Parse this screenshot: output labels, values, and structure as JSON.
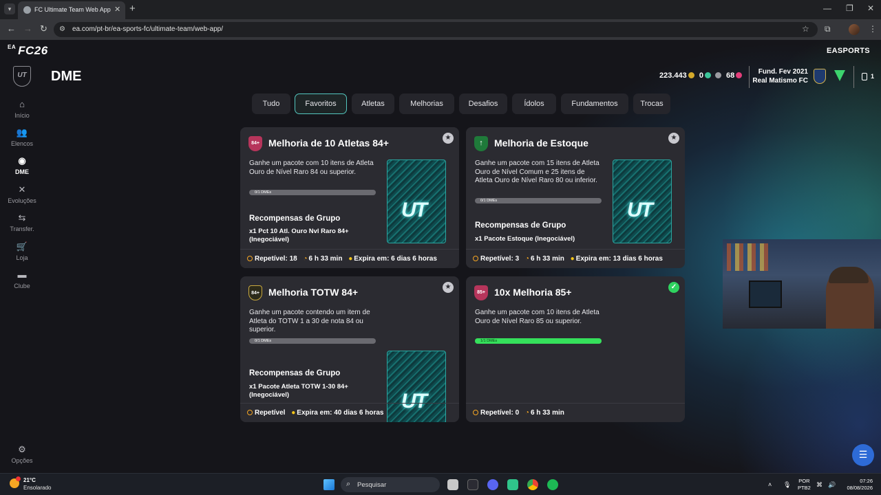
{
  "browser": {
    "tab_title": "FC Ultimate Team Web App - E",
    "url": "ea.com/pt-br/ea-sports-fc/ultimate-team/web-app/"
  },
  "app": {
    "brand": "FC26",
    "brand_prefix": "EA",
    "publisher": "EASPORTS",
    "page_title": "DME",
    "badge_text": "UT"
  },
  "sidebar": {
    "items": [
      {
        "label": "Início",
        "icon": "home-icon"
      },
      {
        "label": "Elencos",
        "icon": "squad-icon"
      },
      {
        "label": "DME",
        "icon": "sbc-icon"
      },
      {
        "label": "Evoluções",
        "icon": "evolutions-icon"
      },
      {
        "label": "Transfer.",
        "icon": "transfer-icon"
      },
      {
        "label": "Loja",
        "icon": "store-icon"
      },
      {
        "label": "Clube",
        "icon": "club-icon"
      }
    ],
    "options_label": "Opções"
  },
  "header": {
    "coins": "223.443",
    "points": "0",
    "fc_points": "68",
    "club_founded": "Fund. Fev 2021",
    "club_name": "Real Matismo FC",
    "inbox_count": "1"
  },
  "filter_tabs": [
    "Tudo",
    "Favoritos",
    "Atletas",
    "Melhorias",
    "Desafios",
    "Ídolos",
    "Fundamentos",
    "Trocas"
  ],
  "selected_tab": "Favoritos",
  "cards": [
    {
      "title": "Melhoria de 10 Atletas 84+",
      "badge": "84+",
      "description": "Ganhe um pacote com 10 itens de Atleta Ouro de Nível Raro 84 ou superior.",
      "progress_label": "0/1 DMEs",
      "progress": 0,
      "group_title": "Recompensas de Grupo",
      "group_reward": "x1 Pct 10 Atl. Ouro Nvl Raro 84+ (Inegociável)",
      "repeatable": "Repetível: 18",
      "timer": "6 h 33 min",
      "expires": "Expira em: 6 dias 6 horas",
      "favorite": true
    },
    {
      "title": "Melhoria de Estoque",
      "badge": "↑",
      "description": "Ganhe um pacote com 15 itens de Atleta Ouro de Nível Comum e 25 itens de Atleta Ouro de Nível Raro 80 ou inferior.",
      "progress_label": "0/1 DMEs",
      "progress": 0,
      "group_title": "Recompensas de Grupo",
      "group_reward": "x1 Pacote Estoque (Inegociável)",
      "repeatable": "Repetível: 3",
      "timer": "6 h 33 min",
      "expires": "Expira em: 13 dias 6 horas",
      "favorite": true
    },
    {
      "title": "Melhoria TOTW 84+",
      "badge": "84+",
      "description": "Ganhe um pacote contendo um item de Atleta do TOTW 1 a 30 de nota 84 ou superior.",
      "progress_label": "0/1 DMEs",
      "progress": 0,
      "group_title": "Recompensas de Grupo",
      "group_reward": "x1 Pacote Atleta TOTW 1-30 84+ (Inegociável)",
      "repeatable": "Repetível",
      "expires": "Expira em: 40 dias 6 horas",
      "favorite": true
    },
    {
      "title": "10x Melhoria 85+",
      "badge": "85+",
      "description": "Ganhe um pacote com 10 itens de Atleta Ouro de Nível Raro 85 ou superior.",
      "progress_label": "1/1 DMEs",
      "progress": 1,
      "repeatable": "Repetível: 0",
      "timer": "6 h 33 min",
      "completed": true
    }
  ],
  "pack_text": "UT",
  "taskbar": {
    "temperature": "21°C",
    "weather": "Ensolarado",
    "search_placeholder": "Pesquisar",
    "lang_1": "POR",
    "lang_2": "PTB2",
    "time": "07:26",
    "date": "08/08/2026"
  },
  "colors": {
    "accent": "#54c8c0",
    "progress_complete": "#35e05b",
    "timer": "#f5a623",
    "completed_check": "#2fd35f"
  }
}
